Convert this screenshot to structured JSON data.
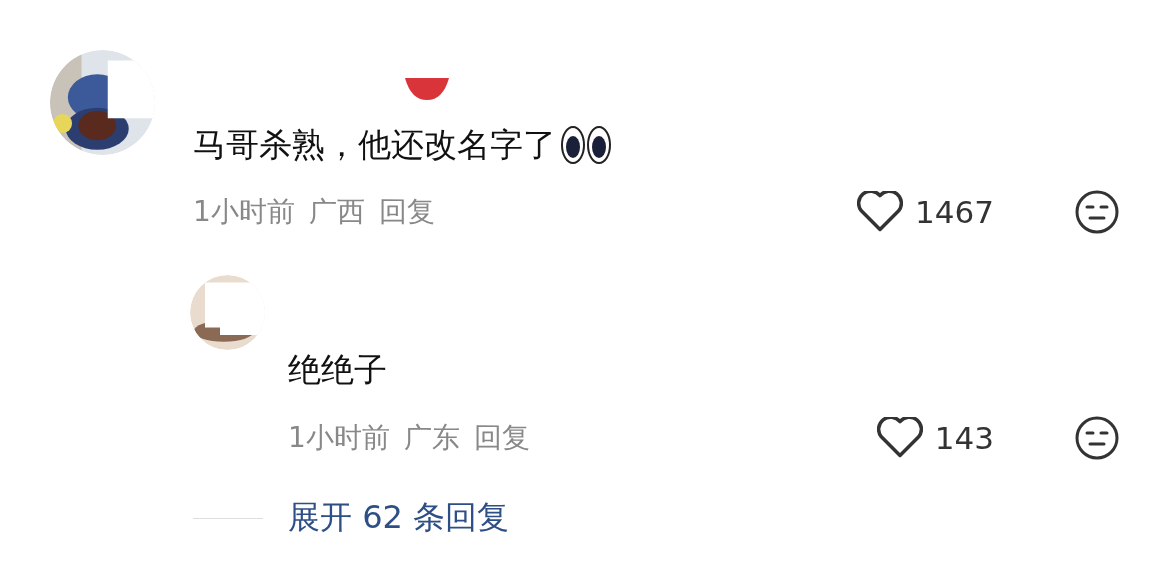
{
  "comments": [
    {
      "text": "马哥杀熟，他还改名字了",
      "time": "1小时前",
      "location": "广西",
      "reply_label": "回复",
      "likes": "1467",
      "replies": [
        {
          "text": "绝绝子",
          "time": "1小时前",
          "location": "广东",
          "reply_label": "回复",
          "likes": "143"
        }
      ]
    }
  ],
  "expand_replies": "展开 62 条回复"
}
